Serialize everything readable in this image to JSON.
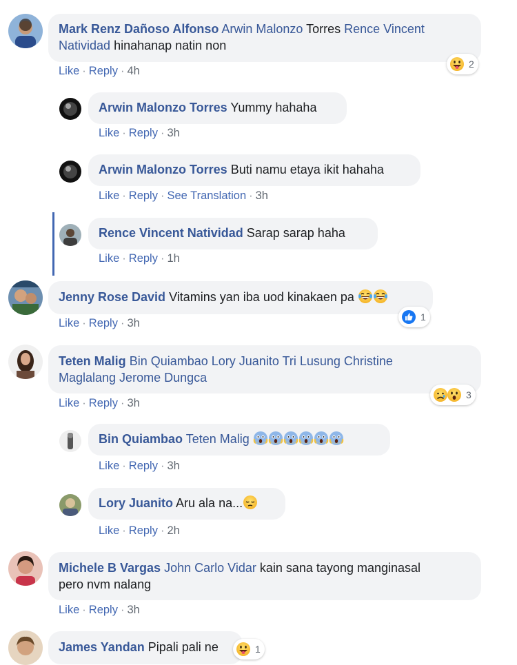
{
  "comments": [
    {
      "author": "Mark Renz Dañoso Alfonso",
      "tags_line1": "Arwin Malonzo",
      "text_line1": "Torres",
      "tags_line1b": "Rence Vincent",
      "tags_line2": "Natividad",
      "text_line2": "hinahanap natin non",
      "actions": {
        "like": "Like",
        "reply": "Reply",
        "time": "4h"
      },
      "reaction_count": "2"
    },
    {
      "author": "Arwin Malonzo Torres",
      "text": "Yummy hahaha",
      "actions": {
        "like": "Like",
        "reply": "Reply",
        "time": "3h"
      }
    },
    {
      "author": "Arwin Malonzo Torres",
      "text": "Buti namu etaya ikit hahaha",
      "actions": {
        "like": "Like",
        "reply": "Reply",
        "translate": "See Translation",
        "time": "3h"
      }
    },
    {
      "author": "Rence Vincent Natividad",
      "text": "Sarap sarap haha",
      "actions": {
        "like": "Like",
        "reply": "Reply",
        "time": "1h"
      }
    },
    {
      "author": "Jenny Rose David",
      "text": "Vitamins yan iba uod kinakaen pa",
      "actions": {
        "like": "Like",
        "reply": "Reply",
        "time": "3h"
      },
      "reaction_count": "1"
    },
    {
      "author": "Teten Malig",
      "tags_line1": "Bin Quiambao Lory Juanito Tri Lusung Christine",
      "tags_line2": "Maglalang Jerome Dungca",
      "actions": {
        "like": "Like",
        "reply": "Reply",
        "time": "3h"
      },
      "reaction_count": "3"
    },
    {
      "author": "Bin Quiambao",
      "tag": "Teten Malig",
      "actions": {
        "like": "Like",
        "reply": "Reply",
        "time": "3h"
      }
    },
    {
      "author": "Lory Juanito",
      "text": "Aru ala na...",
      "actions": {
        "like": "Like",
        "reply": "Reply",
        "time": "2h"
      }
    },
    {
      "author": "Michele B Vargas",
      "tag": "John Carlo Vidar",
      "text_line1": "kain sana tayong manginasal",
      "text_line2": "pero nvm nalang",
      "actions": {
        "like": "Like",
        "reply": "Reply",
        "time": "3h"
      }
    },
    {
      "author": "James Yandan",
      "text": "Pipali pali ne",
      "reaction_count": "1"
    }
  ],
  "separator": "·",
  "colors": {
    "link": "#385898",
    "bubble": "#f2f3f5",
    "thread_line": "#4267b2"
  }
}
